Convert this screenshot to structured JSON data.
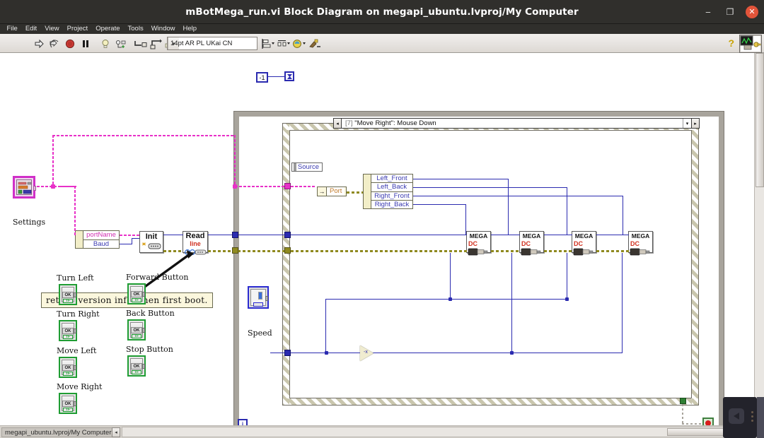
{
  "window": {
    "title": "mBotMega_run.vi Block Diagram on megapi_ubuntu.lvproj/My Computer",
    "minimize_icon": "minimize-icon",
    "maximize_icon": "restore-icon",
    "close_icon": "close-icon",
    "close_glyph": "✕",
    "minimize_glyph": "‒",
    "maximize_glyph": "❐"
  },
  "menubar": {
    "items": [
      {
        "label": "File"
      },
      {
        "label": "Edit"
      },
      {
        "label": "View"
      },
      {
        "label": "Project"
      },
      {
        "label": "Operate"
      },
      {
        "label": "Tools"
      },
      {
        "label": "Window"
      },
      {
        "label": "Help"
      }
    ]
  },
  "toolbar": {
    "buttons": [
      {
        "name": "run-button",
        "icon": "run-arrow-icon",
        "tooltip": "Run"
      },
      {
        "name": "run-continuously-button",
        "icon": "run-continuously-icon",
        "tooltip": "Run Continuously"
      },
      {
        "name": "abort-button",
        "icon": "abort-stop-icon",
        "tooltip": "Abort Execution"
      },
      {
        "name": "pause-button",
        "icon": "pause-icon",
        "tooltip": "Pause"
      },
      {
        "name": "highlight-execution-button",
        "icon": "lightbulb-icon",
        "tooltip": "Highlight Execution"
      },
      {
        "name": "retain-wire-values-button",
        "icon": "retain-wire-values-icon",
        "tooltip": "Retain Wire Values"
      },
      {
        "name": "step-into-button",
        "icon": "step-into-icon",
        "tooltip": "Step Into"
      },
      {
        "name": "step-over-button",
        "icon": "step-over-icon",
        "tooltip": "Step Over"
      },
      {
        "name": "step-out-button",
        "icon": "step-out-icon",
        "tooltip": "Step Out"
      }
    ],
    "font_selector": {
      "value": "14pt AR PL UKai CN",
      "chevron": "▾"
    },
    "right_buttons": [
      {
        "name": "align-objects-button",
        "icon": "align-objects-icon"
      },
      {
        "name": "distribute-objects-button",
        "icon": "distribute-objects-icon"
      },
      {
        "name": "reorder-button",
        "icon": "reorder-icon"
      },
      {
        "name": "cleanup-diagram-button",
        "icon": "cleanup-diagram-icon"
      }
    ],
    "help_icon": "context-help-icon",
    "help_glyph": "?",
    "vi_icon": "vi-icon"
  },
  "diagram": {
    "while_loop": {
      "name": "while-loop",
      "iteration_label": "i",
      "count_constant": "-1"
    },
    "event_structure": {
      "case_label_index": "[7]",
      "case_label_text": "\"Move Right\": Mouse Down",
      "left_arrow": "◂",
      "right_arrow": "▸",
      "dropdown": "▾",
      "event_data_node": "Source"
    },
    "labels": [
      {
        "name": "settings-label",
        "text": "Settings"
      },
      {
        "name": "speed-label",
        "text": "Speed"
      },
      {
        "name": "turn-left-label",
        "text": "Turn Left"
      },
      {
        "name": "turn-right-label",
        "text": "Turn Right"
      },
      {
        "name": "move-left-label",
        "text": "Move Left"
      },
      {
        "name": "move-right-label",
        "text": "Move Right"
      },
      {
        "name": "forward-button-label",
        "text": "Forward Button"
      },
      {
        "name": "back-button-label",
        "text": "Back Button"
      },
      {
        "name": "stop-button-label",
        "text": "Stop Button"
      }
    ],
    "unbundle_settings": {
      "rows": [
        {
          "text": "portName",
          "color_class": "pink"
        },
        {
          "text": "Baud",
          "color_class": "blue"
        }
      ]
    },
    "unbundle_motors": {
      "rows": [
        {
          "text": "Left_Front"
        },
        {
          "text": "Left_Back"
        },
        {
          "text": "Right_Front"
        },
        {
          "text": "Right_Back"
        }
      ]
    },
    "port_node": {
      "text": "Port",
      "arrow": "→"
    },
    "subvis": [
      {
        "name": "serial-init-vi",
        "title": "Init",
        "subtitle": ""
      },
      {
        "name": "serial-read-line-vi",
        "title": "Read",
        "subtitle": "line"
      },
      {
        "name": "mega-dc-motor-vi-1",
        "title": "MEGA",
        "subtitle": "DC"
      },
      {
        "name": "mega-dc-motor-vi-2",
        "title": "MEGA",
        "subtitle": "DC"
      },
      {
        "name": "mega-dc-motor-vi-3",
        "title": "MEGA",
        "subtitle": "DC"
      },
      {
        "name": "mega-dc-motor-vi-4",
        "title": "MEGA",
        "subtitle": "DC"
      }
    ],
    "comment": {
      "text": "return version info when first boot."
    },
    "boolean_terminal_text": {
      "ok": "OK",
      "tf": "TF"
    },
    "stop_terminal": "stop-condition-terminal"
  },
  "statusbar": {
    "project_path": "megapi_ubuntu.lvproj/My Computer",
    "nav_arrow": "◂"
  },
  "colors": {
    "titlebar_bg": "#302f2c",
    "close_button": "#e2543a",
    "wire_blue": "#2b2bb0",
    "wire_pink": "#e831c8",
    "wire_olive": "#8f8a20",
    "loop_border": "#a8a49c",
    "bool_terminal": "#1f9d33",
    "cluster_terminal": "#d030c8",
    "canvas_bg": "#ffffff"
  }
}
